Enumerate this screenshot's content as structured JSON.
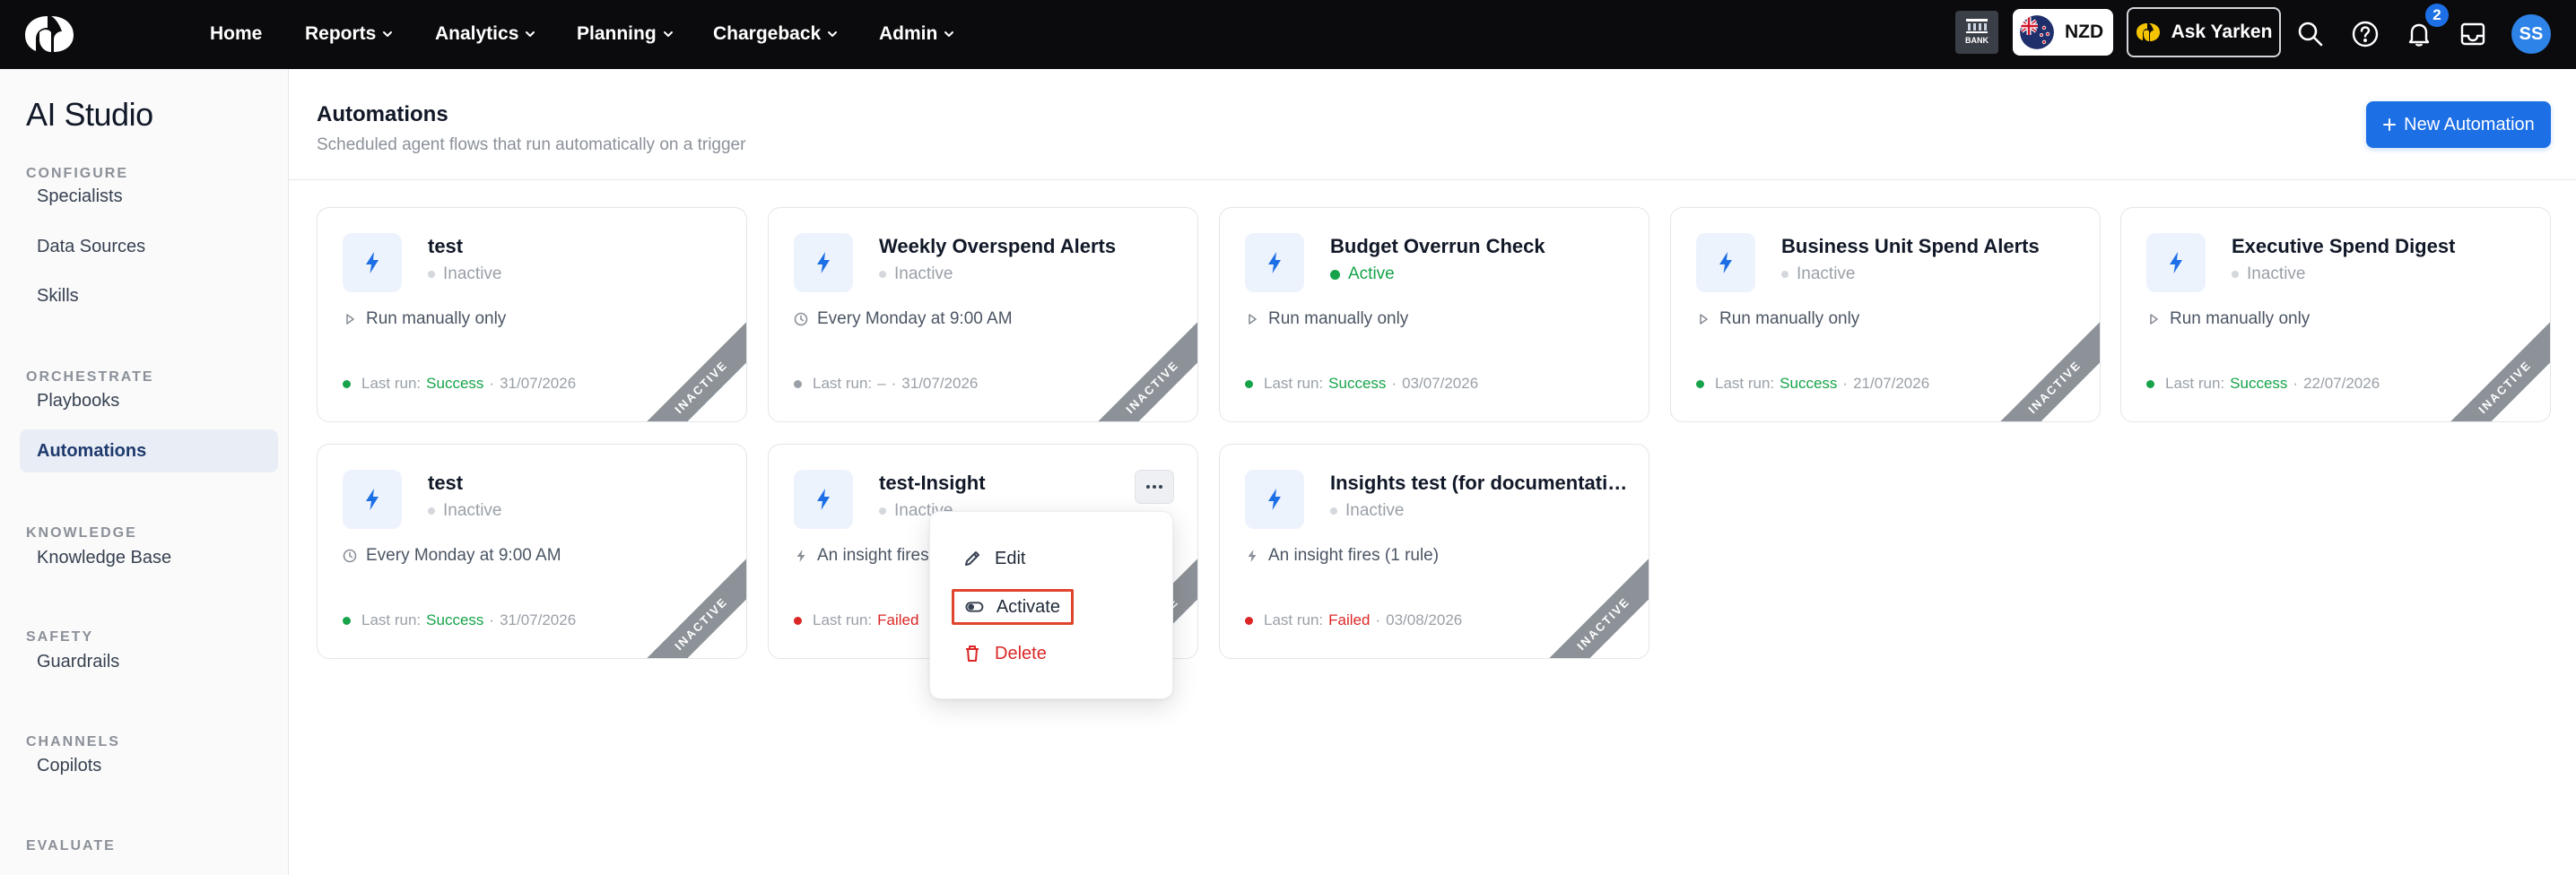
{
  "topbar": {
    "nav": [
      {
        "label": "Home",
        "has_menu": false
      },
      {
        "label": "Reports",
        "has_menu": true
      },
      {
        "label": "Analytics",
        "has_menu": true
      },
      {
        "label": "Planning",
        "has_menu": true
      },
      {
        "label": "Chargeback",
        "has_menu": true
      },
      {
        "label": "Admin",
        "has_menu": true
      }
    ],
    "bank_label": "BANK",
    "currency": "NZD",
    "ask_label": "Ask Yarken",
    "notification_count": "2",
    "avatar_initials": "SS",
    "brand_color": "#0b0b0d",
    "accent_color": "#1d6fe6"
  },
  "sidebar": {
    "title": "AI Studio",
    "sections": [
      {
        "label": "CONFIGURE",
        "items": [
          "Specialists",
          "Data Sources",
          "Skills"
        ]
      },
      {
        "label": "ORCHESTRATE",
        "items": [
          "Playbooks",
          "Automations"
        ]
      },
      {
        "label": "KNOWLEDGE",
        "items": [
          "Knowledge Base"
        ]
      },
      {
        "label": "SAFETY",
        "items": [
          "Guardrails"
        ]
      },
      {
        "label": "CHANNELS",
        "items": [
          "Copilots"
        ]
      },
      {
        "label": "EVALUATE",
        "items": []
      }
    ],
    "active_item": "Automations"
  },
  "main": {
    "title": "Automations",
    "subtitle": "Scheduled agent flows that run automatically on a trigger",
    "new_button": "New Automation",
    "new_button_icon": "plus-icon",
    "last_run_label": "Last run:",
    "cards": [
      {
        "title": "test",
        "status": "Inactive",
        "trigger_icon": "play-icon",
        "trigger": "Run manually only",
        "result": "Success",
        "date": "31/07/2026",
        "ribbon": "INACTIVE"
      },
      {
        "title": "Weekly Overspend Alerts",
        "status": "Inactive",
        "trigger_icon": "clock-icon",
        "trigger": "Every Monday at 9:00 AM",
        "result": "–",
        "date": "31/07/2026",
        "ribbon": "INACTIVE"
      },
      {
        "title": "Budget Overrun Check",
        "status": "Active",
        "trigger_icon": "play-icon",
        "trigger": "Run manually only",
        "result": "Success",
        "date": "03/07/2026",
        "ribbon": ""
      },
      {
        "title": "Business Unit Spend Alerts",
        "status": "Inactive",
        "trigger_icon": "play-icon",
        "trigger": "Run manually only",
        "result": "Success",
        "date": "21/07/2026",
        "ribbon": "INACTIVE"
      },
      {
        "title": "Executive Spend Digest",
        "status": "Inactive",
        "trigger_icon": "play-icon",
        "trigger": "Run manually only",
        "result": "Success",
        "date": "22/07/2026",
        "ribbon": "INACTIVE"
      },
      {
        "title": "test",
        "status": "Inactive",
        "trigger_icon": "clock-icon",
        "trigger": "Every Monday at 9:00 AM",
        "result": "Success",
        "date": "31/07/2026",
        "ribbon": "INACTIVE"
      },
      {
        "title": "test-Insight",
        "status": "Inactive",
        "trigger_icon": "bolt-icon",
        "trigger": "An insight fires",
        "result": "Failed",
        "date": "",
        "ribbon": "INACTIVE",
        "menu_open": true
      },
      {
        "title": "Insights test (for documentation purposes)",
        "status": "Inactive",
        "trigger_icon": "bolt-icon",
        "trigger": "An insight fires (1 rule)",
        "result": "Failed",
        "date": "03/08/2026",
        "ribbon": "INACTIVE"
      }
    ]
  },
  "menu": {
    "items": [
      {
        "label": "Edit",
        "icon": "pencil-icon"
      },
      {
        "label": "Activate",
        "icon": "toggle-icon"
      },
      {
        "label": "Delete",
        "icon": "trash-icon"
      }
    ]
  },
  "colors": {
    "success": "#16a34a",
    "failed": "#dc2626",
    "inactive_ribbon": "#8d9298",
    "highlight_outline": "#e0442c"
  }
}
